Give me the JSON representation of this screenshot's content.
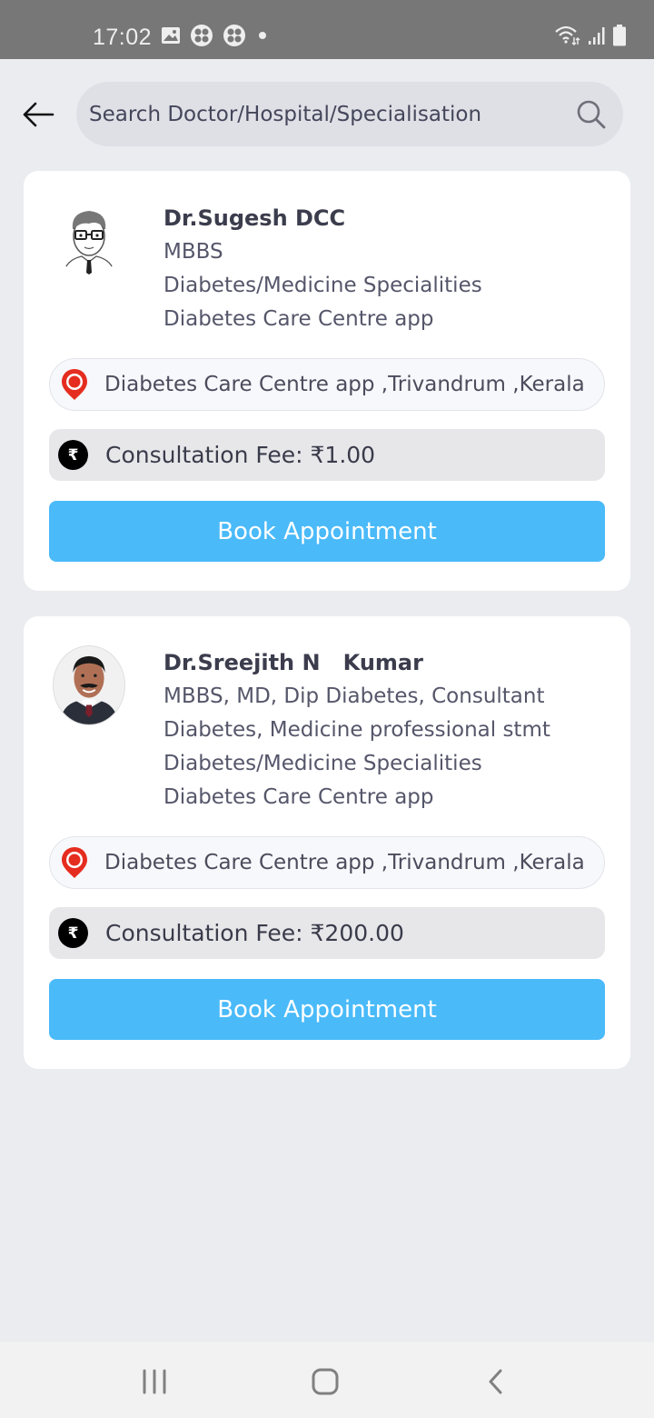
{
  "status_bar": {
    "time": "17:02",
    "left_icons": [
      "gallery-icon",
      "app-icon",
      "app-icon",
      "notification-dot-icon"
    ],
    "right_icons": [
      "wifi-icon",
      "signal-icon",
      "battery-icon"
    ]
  },
  "header": {
    "back_icon": "arrow-left-icon",
    "search_placeholder": "Search Doctor/Hospital/Specialisation",
    "search_value": "",
    "search_icon": "search-icon"
  },
  "doctors": [
    {
      "name": "Dr.Sugesh DCC",
      "details": [
        "MBBS",
        "Diabetes/Medicine Specialities",
        "Diabetes Care Centre app"
      ],
      "avatar": "cartoon-doctor-avatar",
      "location": "Diabetes Care Centre app ,Trivandrum ,Kerala",
      "fee_label": "Consultation Fee: ₹1.00",
      "book_label": "Book Appointment"
    },
    {
      "name": "Dr.Sreejith N   Kumar",
      "details": [
        "MBBS, MD, Dip Diabetes, Consultant",
        "Diabetes, Medicine professional stmt",
        "Diabetes/Medicine Specialities",
        "Diabetes Care Centre app"
      ],
      "avatar": "doctor-photo-avatar",
      "location": "Diabetes Care Centre app ,Trivandrum ,Kerala",
      "fee_label": "Consultation Fee: ₹200.00",
      "book_label": "Book Appointment"
    }
  ],
  "rupee_symbol": "₹",
  "colors": {
    "accent": "#4abaf9",
    "pin": "#e52d1f",
    "background": "#ebecf0"
  },
  "nav_bar": [
    "recent-apps-icon",
    "home-icon",
    "back-icon"
  ]
}
